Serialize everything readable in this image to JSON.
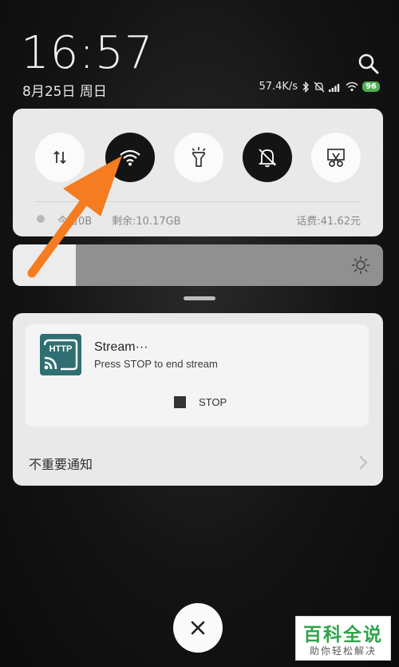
{
  "status_bar": {
    "time": "16:57",
    "date": "8月25日 周日",
    "net_speed": "57.4K/s",
    "battery": "96",
    "icons": [
      "bluetooth-icon",
      "silent-icon",
      "signal-icon",
      "wifi-icon",
      "battery-icon"
    ]
  },
  "quick_settings": {
    "toggles": [
      {
        "name": "mobile-data",
        "icon": "data-arrows-icon",
        "active": false
      },
      {
        "name": "wifi",
        "icon": "wifi-icon",
        "active": true
      },
      {
        "name": "flashlight",
        "icon": "flashlight-icon",
        "active": false
      },
      {
        "name": "silent",
        "icon": "bell-off-icon",
        "active": true
      },
      {
        "name": "screenshot",
        "icon": "scissors-icon",
        "active": false
      }
    ],
    "data_today": "今日0B",
    "data_remaining": "剩余:10.17GB",
    "phone_fee": "话费:41.62元"
  },
  "brightness": {
    "level": 0.17
  },
  "notification": {
    "app_icon_text": "HTTP",
    "title": "Stream···",
    "text": "Press STOP to end stream",
    "action": "STOP",
    "footer": "不重要通知"
  },
  "watermark": {
    "title": "百科全说",
    "subtitle": "助你轻松解决"
  },
  "colors": {
    "arrow": "#f57c20",
    "active_toggle": "#141414",
    "app_icon": "#2f6f72",
    "battery": "#4caf50"
  }
}
